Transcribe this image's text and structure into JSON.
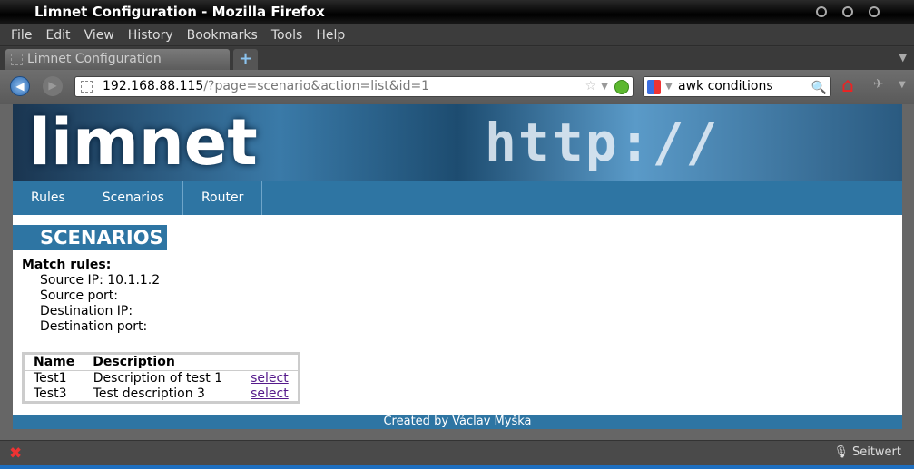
{
  "window": {
    "title": "Limnet Configuration - Mozilla Firefox"
  },
  "menu": [
    "File",
    "Edit",
    "View",
    "History",
    "Bookmarks",
    "Tools",
    "Help"
  ],
  "tab": {
    "label": "Limnet Configuration",
    "new_tab": "+"
  },
  "url": {
    "host": "192.168.88.115",
    "rest": "/?page=scenario&action=list&id=1"
  },
  "search": {
    "value": "awk conditions"
  },
  "banner": {
    "logo": "limnet",
    "graphic_text": "http://"
  },
  "nav": [
    "Rules",
    "Scenarios",
    "Router"
  ],
  "page": {
    "heading": "SCENARIOS",
    "match_title": "Match rules:",
    "rules": [
      "Source IP: 10.1.1.2",
      "Source port:",
      "Destination IP:",
      "Destination port:"
    ],
    "table": {
      "headers": [
        "Name",
        "Description"
      ],
      "rows": [
        {
          "name": "Test1",
          "desc": "Description of test 1",
          "action": "select"
        },
        {
          "name": "Test3",
          "desc": "Test description 3",
          "action": "select"
        }
      ]
    },
    "footer": "Created by Václav Myška"
  },
  "statusbar": {
    "right": "Seitwert"
  },
  "colors": {
    "accent": "#2e75a3",
    "link": "#551a8b"
  }
}
